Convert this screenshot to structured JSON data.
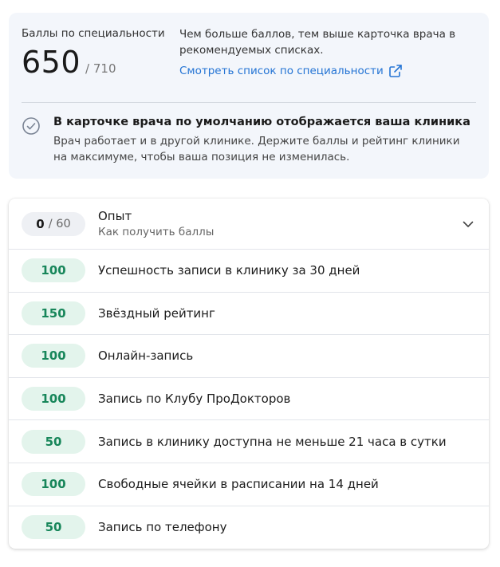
{
  "summary": {
    "label": "Баллы по специальности",
    "score": "650",
    "max": "/ 710",
    "description": "Чем больше баллов, тем выше карточка врача в рекомендуемых списках.",
    "link_label": "Смотреть список по специальности",
    "link_icon": "external-link-icon"
  },
  "notice": {
    "icon": "check-circle-icon",
    "title": "В карточке врача по умолчанию отображается ваша клиника",
    "text": "Врач работает и в другой клинике. Держите баллы и рейтинг клиники на максимуме, чтобы ваша позиция не изменилась."
  },
  "experience": {
    "score": "0",
    "max": "/ 60",
    "title": "Опыт",
    "subtitle": "Как получить баллы",
    "icon": "chevron-down-icon"
  },
  "items": [
    {
      "points": "100",
      "label": "Успешность записи в клинику за 30 дней"
    },
    {
      "points": "150",
      "label": "Звёздный рейтинг"
    },
    {
      "points": "100",
      "label": "Онлайн-запись"
    },
    {
      "points": "100",
      "label": "Запись по Клубу ПроДокторов"
    },
    {
      "points": "50",
      "label": "Запись в клинику доступна не меньше 21 часа в сутки"
    },
    {
      "points": "100",
      "label": "Свободные ячейки в расписании на 14 дней"
    },
    {
      "points": "50",
      "label": "Запись по телефону"
    }
  ],
  "colors": {
    "accent_link": "#2474d4",
    "pill_green_bg": "#e3f4ec",
    "pill_green_text": "#17865a",
    "summary_bg": "#f3f6fb"
  }
}
